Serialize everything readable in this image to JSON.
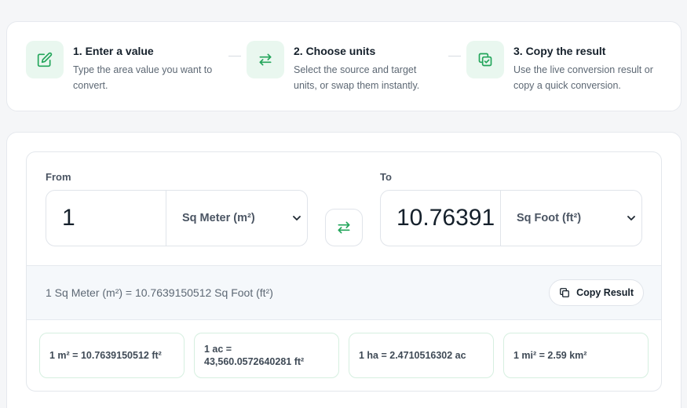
{
  "steps": [
    {
      "title": "1. Enter a value",
      "desc_line1": "Type the area value you want to",
      "desc_line2": "convert.",
      "icon": "edit-icon"
    },
    {
      "title": "2. Choose units",
      "desc_line1": "Select the source and target",
      "desc_line2": "units, or swap them instantly.",
      "icon": "swap-icon"
    },
    {
      "title": "3. Copy the result",
      "desc_line1": "Use the live conversion result or",
      "desc_line2": "copy a quick conversion.",
      "icon": "copy-check-icon"
    }
  ],
  "converter": {
    "from_label": "From",
    "from_value": "1",
    "from_unit": "Sq Meter (m²)",
    "to_label": "To",
    "to_value": "10.76391",
    "to_unit": "Sq Foot (ft²)",
    "swap_icon": "swap-icon"
  },
  "result": {
    "text": "1 Sq Meter (m²) = 10.7639150512 Sq Foot (ft²)",
    "copy_label": "Copy Result",
    "copy_icon": "copy-icon"
  },
  "quick_conversions": [
    {
      "line1": "1 m² = 10.7639150512 ft²",
      "line2": ""
    },
    {
      "line1": "1 ac =",
      "line2": "43,560.0572640281 ft²"
    },
    {
      "line1": "1 ha = 2.4710516302 ac",
      "line2": ""
    },
    {
      "line1": "1 mi² = 2.59 km²",
      "line2": ""
    }
  ],
  "colors": {
    "accent": "#22a55a",
    "accent_bg": "#e9f7ef"
  }
}
